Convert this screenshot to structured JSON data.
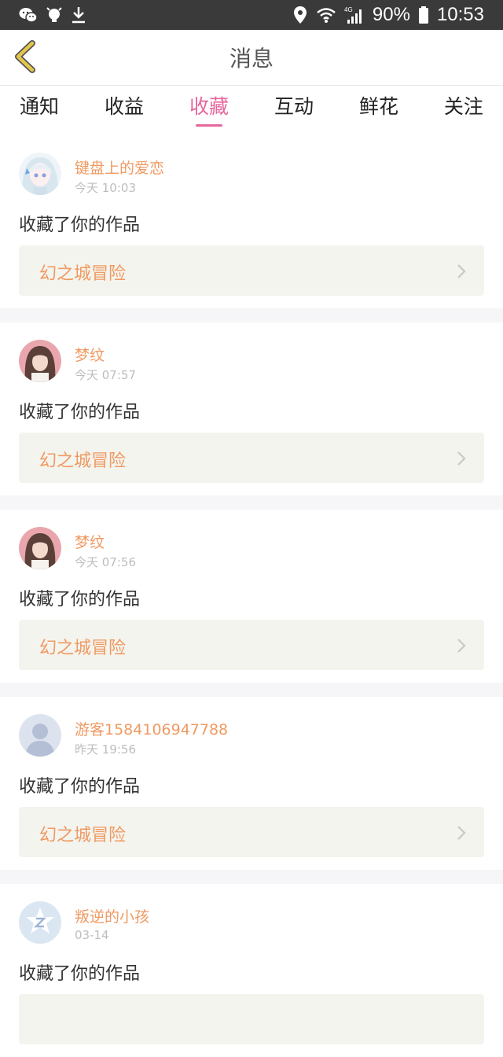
{
  "status_bar": {
    "icons_left": [
      "wechat-icon",
      "notification-bulb-icon",
      "download-icon"
    ],
    "icons_right": [
      "location-icon",
      "wifi-icon",
      "signal-4g-icon",
      "battery-icon"
    ],
    "network": "4G",
    "battery": "90%",
    "time": "10:53"
  },
  "header": {
    "title": "消息",
    "back_icon": "chevron-left-icon",
    "accent_color": "#e2c64a"
  },
  "tabs": [
    {
      "label": "通知"
    },
    {
      "label": "收益"
    },
    {
      "label": "收藏",
      "active": true
    },
    {
      "label": "互动"
    },
    {
      "label": "鲜花"
    },
    {
      "label": "关注"
    }
  ],
  "accent": {
    "active_tab": "#e7669d",
    "username": "#ef9a62"
  },
  "messages": [
    {
      "user": "键盘上的爱恋",
      "time": "今天 10:03",
      "action": "收藏了你的作品",
      "work": "幻之城冒险",
      "avatar": "anime-girl-avatar"
    },
    {
      "user": "梦纹",
      "time": "今天 07:57",
      "action": "收藏了你的作品",
      "work": "幻之城冒险",
      "avatar": "photo-girl-avatar"
    },
    {
      "user": "梦纹",
      "time": "今天 07:56",
      "action": "收藏了你的作品",
      "work": "幻之城冒险",
      "avatar": "photo-girl-avatar"
    },
    {
      "user": "游客1584106947788",
      "time": "昨天 19:56",
      "action": "收藏了你的作品",
      "work": "幻之城冒险",
      "avatar": "default-person-avatar"
    },
    {
      "user": "叛逆的小孩",
      "time": "03-14",
      "action": "收藏了你的作品",
      "work": "",
      "avatar": "qq-default-avatar"
    }
  ]
}
